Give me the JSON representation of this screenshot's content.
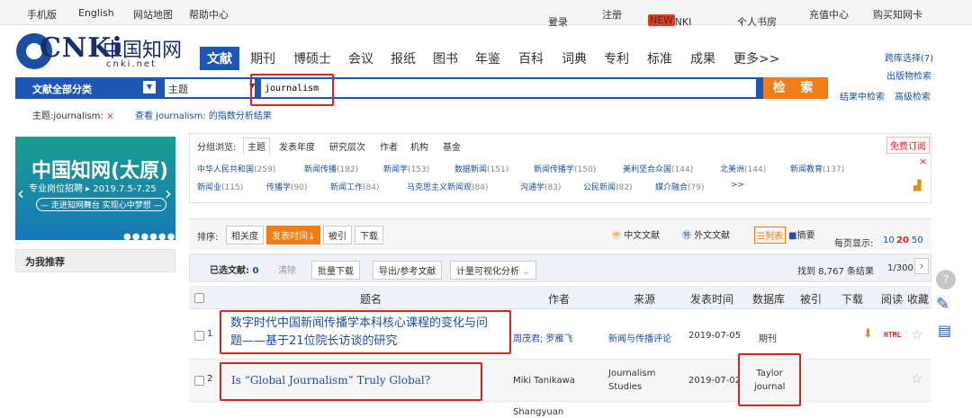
{
  "topbar": {
    "links": [
      "手机版",
      "English",
      "网站地图",
      "帮助中心"
    ],
    "login": "登录",
    "register": "注册",
    "my_cnki": "我的CNKI",
    "new_badge": "NEW",
    "personal_library": "个人书房",
    "recharge": "充值中心",
    "buy_card": "购买知网卡"
  },
  "logo": {
    "text": "CNKi",
    "cn": "中国知网",
    "sub": "cnki.net"
  },
  "nav": {
    "tabs": [
      "文献",
      "期刊",
      "博硕士",
      "会议",
      "报纸",
      "图书",
      "年鉴",
      "百科",
      "词典",
      "专利",
      "标准",
      "成果",
      "更多>>"
    ],
    "active": "文献"
  },
  "right_links": {
    "cross": "跨库选择(7)",
    "publication": "出版物检索",
    "in_results": "结果中检索",
    "advanced": "高级检索"
  },
  "search": {
    "category": "文献全部分类",
    "field": "主题",
    "query": "journalism",
    "button": "检 索"
  },
  "crumbs": {
    "topic": "主题:journalism:",
    "close": "×",
    "index_prefix": "查看 journalism: 的指数分析结果"
  },
  "banner": {
    "title": "中国知网(太原)",
    "line2": "专业岗位招聘 ▸ 2019.7.5-7.25",
    "line3": "— 走进知网舞台 实现心中梦想 —"
  },
  "recommend": "为我推荐",
  "group": {
    "label": "分组浏览:",
    "tabs": [
      "主题",
      "发表年度",
      "研究层次",
      "作者",
      "机构",
      "基金"
    ],
    "subscribe": "免费订阅",
    "items_row1": [
      {
        "name": "中华人民共和国",
        "count": "(259)"
      },
      {
        "name": "新闻传播",
        "count": "(182)"
      },
      {
        "name": "新闻学",
        "count": "(153)"
      },
      {
        "name": "数据新闻",
        "count": "(151)"
      },
      {
        "name": "新闻传播学",
        "count": "(150)"
      },
      {
        "name": "美利坚合众国",
        "count": "(144)"
      },
      {
        "name": "北美洲",
        "count": "(144)"
      },
      {
        "name": "新闻教育",
        "count": "(137)"
      }
    ],
    "items_row2": [
      {
        "name": "新闻业",
        "count": "(115)"
      },
      {
        "name": "传播学",
        "count": "(90)"
      },
      {
        "name": "新闻工作",
        "count": "(84)"
      },
      {
        "name": "马克思主义新闻观",
        "count": "(84)"
      },
      {
        "name": "沟通学",
        "count": "(83)"
      },
      {
        "name": "公民新闻",
        "count": "(82)"
      },
      {
        "name": "媒介融合",
        "count": "(79)"
      }
    ],
    "more": ">>"
  },
  "sort": {
    "label": "排序:",
    "options": [
      "相关度",
      "发表时间",
      "被引",
      "下载"
    ],
    "active": "发表时间",
    "cn_docs": "中文文献",
    "foreign_docs": "外文文献",
    "list": "列表",
    "abstract": "摘要",
    "per_page_label": "每页显示:",
    "per_page": [
      "10",
      "20",
      "50"
    ],
    "per_page_active": "20"
  },
  "toolbar": {
    "selected_label": "已选文献:",
    "selected_count": "0",
    "clear": "清除",
    "batch_download": "批量下载",
    "export": "导出/参考文献",
    "visual": "计量可视化分析",
    "found": "找到 8,767 条结果",
    "pages": "1/300"
  },
  "table": {
    "headers": [
      "题名",
      "作者",
      "来源",
      "发表时间",
      "数据库",
      "被引",
      "下载",
      "阅读",
      "收藏"
    ],
    "rows": [
      {
        "num": "1",
        "title_l1": "数字时代中国新闻传播学本科核心课程的变化与问",
        "title_l2": "题——基于21位院长访谈的研究",
        "author": "周茂君; 罗雁飞",
        "source": "新闻与传播评论",
        "date": "2019-07-05",
        "db": "期刊",
        "read": "HTML"
      },
      {
        "num": "2",
        "title_l1": "Is “Global Journalism” Truly Global?",
        "author": "Miki Tanikawa",
        "source_l1": "Journalism",
        "source_l2": "Studies",
        "date": "2019-07-02",
        "db_l1": "Taylor",
        "db_l2": "journal"
      }
    ],
    "row3_author": "Shangyuan"
  }
}
